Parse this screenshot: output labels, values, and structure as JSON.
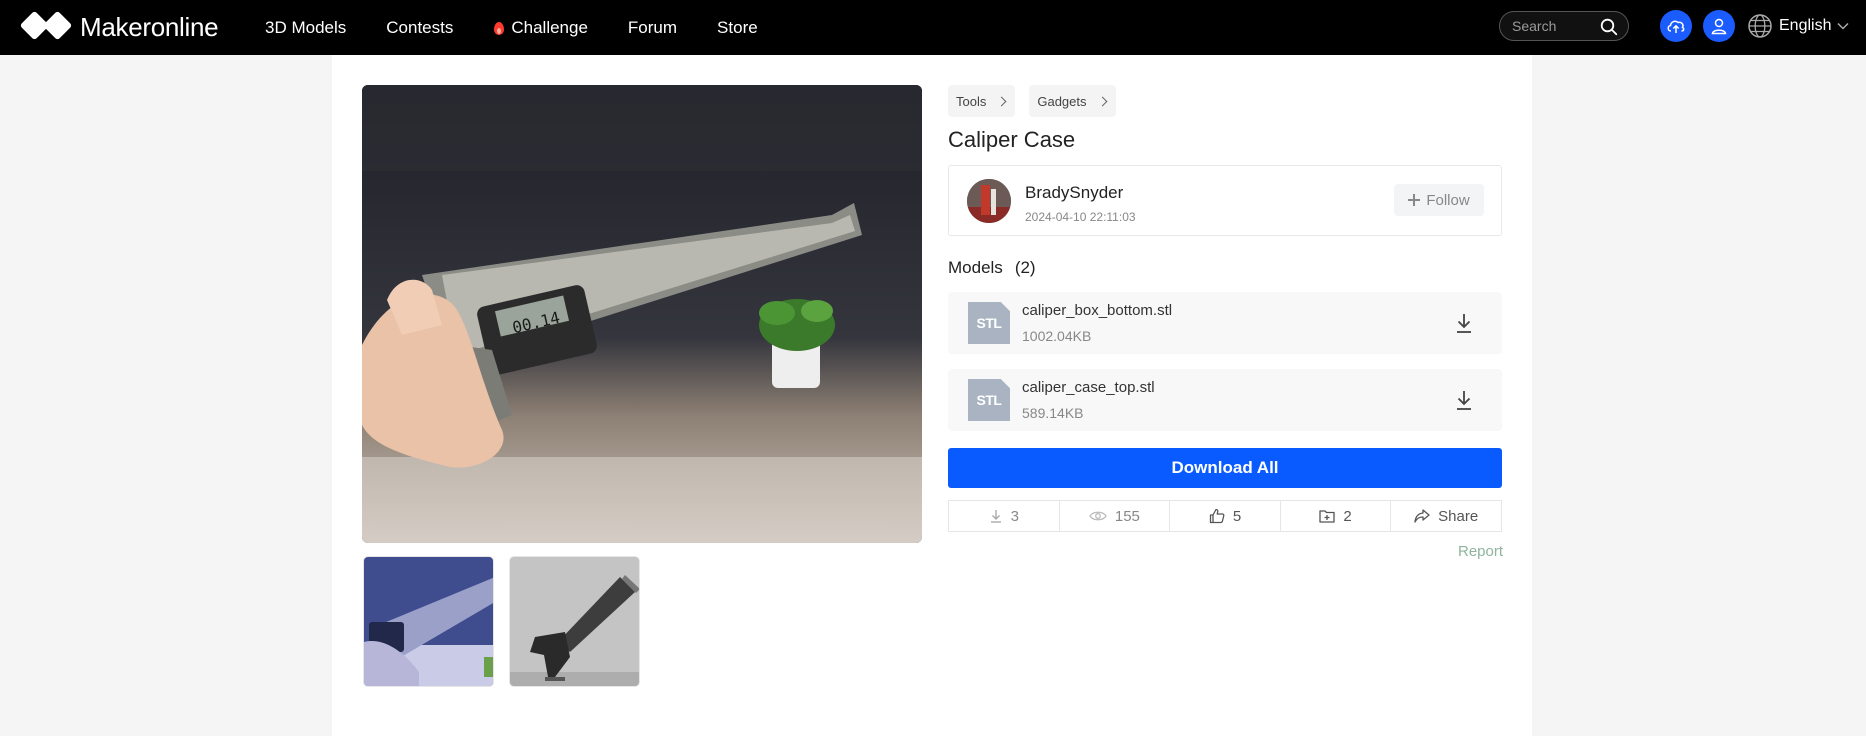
{
  "brand": {
    "name": "Makeronline"
  },
  "nav": {
    "items": [
      {
        "label": "3D Models"
      },
      {
        "label": "Contests"
      },
      {
        "label": "Challenge",
        "icon": "flame-icon"
      },
      {
        "label": "Forum"
      },
      {
        "label": "Store"
      }
    ],
    "search_placeholder": "Search",
    "language": "English"
  },
  "colors": {
    "accent": "#0a5bff",
    "nav_bg": "#000000",
    "report": "#8fb39e"
  },
  "breadcrumbs": [
    {
      "label": "Tools"
    },
    {
      "label": "Gadgets"
    }
  ],
  "title": "Caliper Case",
  "author": {
    "name": "BradySnyder",
    "date": "2024-04-10 22:11:03",
    "follow_label": "Follow"
  },
  "models": {
    "heading": "Models",
    "count": "(2)",
    "files": [
      {
        "type": "STL",
        "name": "caliper_box_bottom.stl",
        "size": "1002.04KB"
      },
      {
        "type": "STL",
        "name": "caliper_case_top.stl",
        "size": "589.14KB"
      }
    ]
  },
  "download_all_label": "Download All",
  "stats": {
    "downloads": "3",
    "views": "155",
    "likes": "5",
    "collections": "2",
    "share_label": "Share"
  },
  "report_label": "Report"
}
